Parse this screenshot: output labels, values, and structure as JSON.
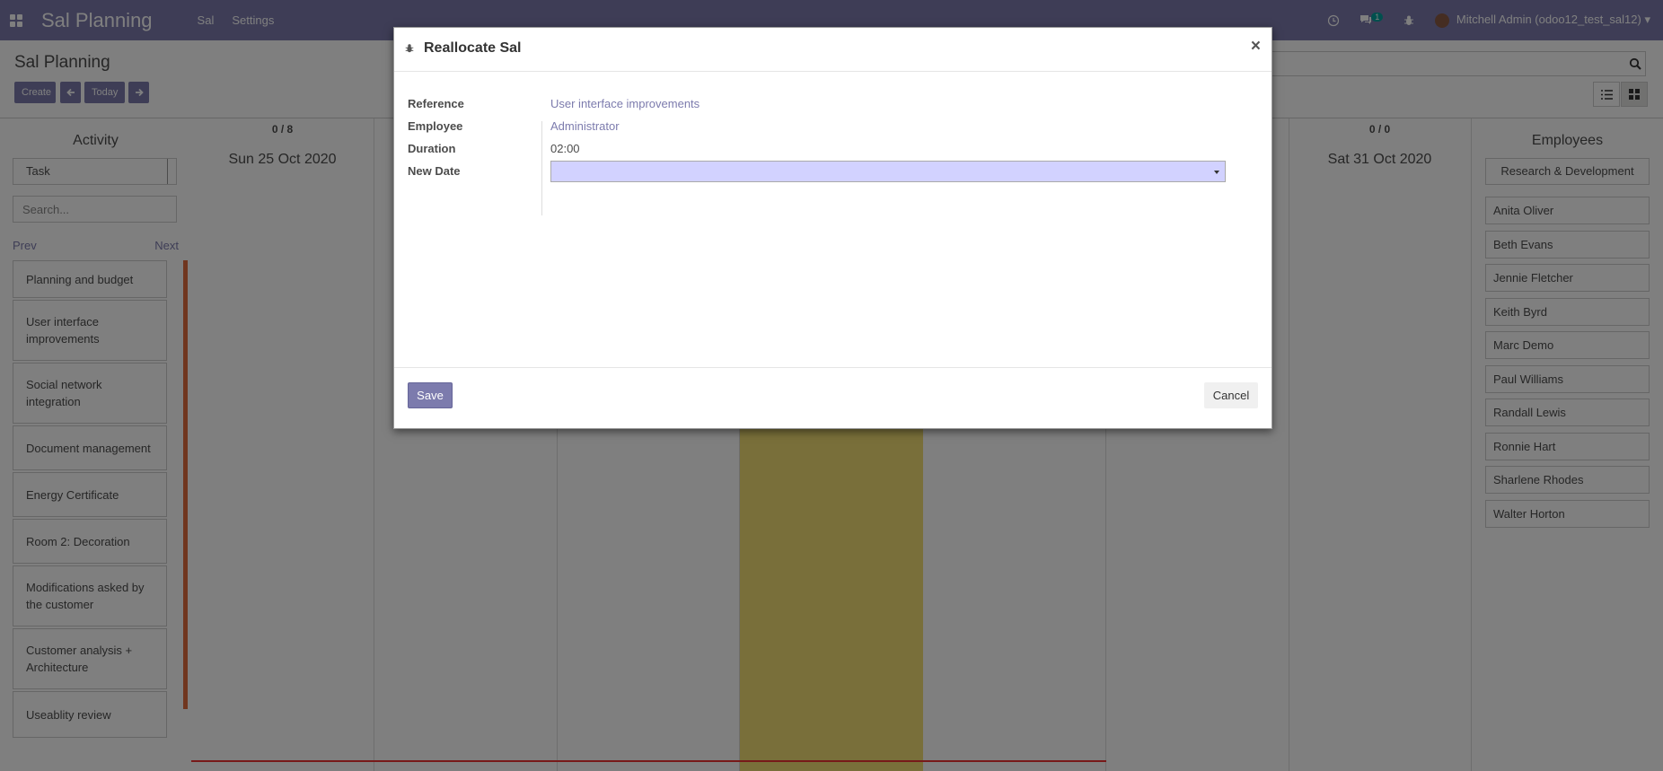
{
  "navbar": {
    "brand": "Sal Planning",
    "menu": [
      "Sal",
      "Settings"
    ],
    "chat_count": "1",
    "user": "Mitchell Admin (odoo12_test_sal12)"
  },
  "control": {
    "title": "Sal Planning",
    "create": "Create",
    "today": "Today"
  },
  "left": {
    "title": "Activity",
    "select_value": "Task",
    "search_placeholder": "Search...",
    "prev": "Prev",
    "next": "Next",
    "tasks": [
      "Planning and budget",
      "User interface improvements",
      "Social network integration",
      "Document management",
      "Energy Certificate",
      "Room 2: Decoration",
      "Modifications asked by the customer",
      "Customer analysis + Architecture",
      "Useablity review"
    ]
  },
  "calendar": {
    "columns": [
      {
        "count": "0 / 8",
        "day": "Sun 25 Oct 2020"
      },
      {
        "count": "",
        "day": ""
      },
      {
        "count": "",
        "day": ""
      },
      {
        "count": "",
        "day": ""
      },
      {
        "count": "",
        "day": ""
      },
      {
        "count": "",
        "day": ""
      },
      {
        "count": "0 / 0",
        "day": "Sat 31 Oct 2020"
      }
    ]
  },
  "right": {
    "title": "Employees",
    "select_value": "Research & Development",
    "employees": [
      "Anita Oliver",
      "Beth Evans",
      "Jennie Fletcher",
      "Keith Byrd",
      "Marc Demo",
      "Paul Williams",
      "Randall Lewis",
      "Ronnie Hart",
      "Sharlene Rhodes",
      "Walter Horton"
    ]
  },
  "modal": {
    "title": "Reallocate Sal",
    "close": "×",
    "fields": {
      "reference_label": "Reference",
      "reference_value": "User interface improvements",
      "employee_label": "Employee",
      "employee_value": "Administrator",
      "duration_label": "Duration",
      "duration_value": "02:00",
      "new_date_label": "New Date",
      "new_date_value": ""
    },
    "save": "Save",
    "cancel": "Cancel"
  }
}
